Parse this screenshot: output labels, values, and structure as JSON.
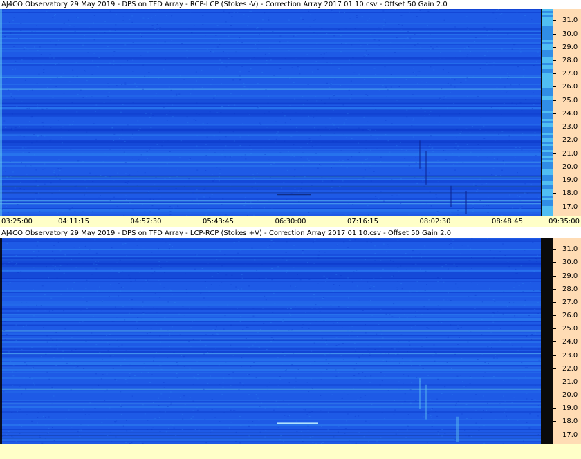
{
  "panels": [
    {
      "title": "AJ4CO Observatory 29 May 2019  -  DPS on TFD Array  -  RCP-LCP (Stokes -V)  -  Correction Array 2017 01 10.csv  -  Offset 50  Gain 2.0"
    },
    {
      "title": "AJ4CO Observatory 29 May 2019  -  DPS on TFD Array  -  LCP-RCP (Stokes +V)  -  Correction Array 2017 01 10.csv  -  Offset 50  Gain 2.0"
    }
  ],
  "chart_data": [
    {
      "type": "heatmap",
      "title": "AJ4CO Observatory 29 May 2019  -  DPS on TFD Array  -  RCP-LCP (Stokes -V)  -  Correction Array 2017 01 10.csv  -  Offset 50  Gain 2.0",
      "x_ticks": [
        "03:25:00",
        "04:11:15",
        "04:57:30",
        "05:43:45",
        "06:30:00",
        "07:16:15",
        "08:02:30",
        "08:48:45",
        "09:35:00"
      ],
      "xlim": [
        "03:25:00",
        "09:35:00"
      ],
      "y_ticks": [
        "31.0",
        "30.0",
        "29.0",
        "28.0",
        "27.0",
        "26.0",
        "25.0",
        "24.0",
        "23.0",
        "22.0",
        "21.0",
        "20.0",
        "19.0",
        "18.0",
        "17.0"
      ],
      "ylim": [
        16.3,
        31.9
      ],
      "colormap": [
        "#0a35c8",
        "#1e5ae6",
        "#2f86f2",
        "#5fc0f0"
      ]
    },
    {
      "type": "heatmap",
      "title": "AJ4CO Observatory 29 May 2019  -  DPS on TFD Array  -  LCP-RCP (Stokes +V)  -  Correction Array 2017 01 10.csv  -  Offset 50  Gain 2.0",
      "y_ticks": [
        "31.0",
        "30.0",
        "29.0",
        "28.0",
        "27.0",
        "26.0",
        "25.0",
        "24.0",
        "23.0",
        "22.0",
        "21.0",
        "20.0",
        "19.0",
        "18.0",
        "17.0"
      ],
      "ylim": [
        16.3,
        31.9
      ],
      "colormap": [
        "#0a35c8",
        "#1e5ae6",
        "#2f86f2",
        "#5fc0f0"
      ]
    }
  ],
  "colors": {
    "axis_bg": "#ffdcb4",
    "xaxis_bg": "#ffffc8",
    "divider": "#0a0a0a"
  }
}
